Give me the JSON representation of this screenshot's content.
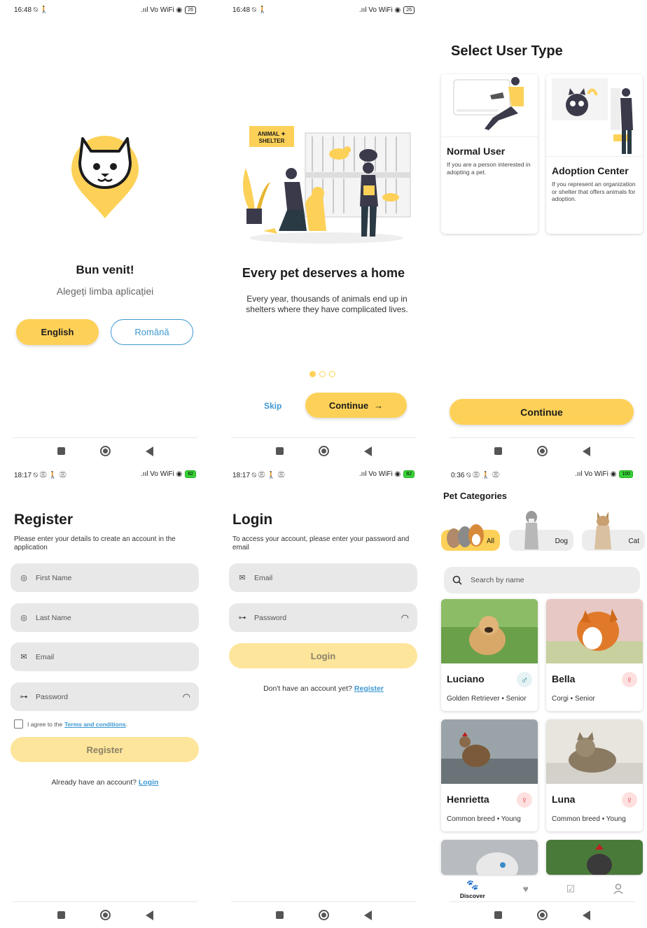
{
  "screen1": {
    "status": {
      "time": "16:48 ⍉ 🚶",
      "icons": ".ııl Vo WiFi ◉",
      "battery": "26"
    },
    "welcome": "Bun venit!",
    "subtitle": "Alegeți limba aplicației",
    "english": "English",
    "romana": "Română"
  },
  "screen2": {
    "status": {
      "time": "16:48 ⍉ 🚶",
      "icons": ".ııl Vo WiFi ◉",
      "battery": "26"
    },
    "sign": "ANIMAL SHELTER",
    "title": "Every pet deserves a home",
    "desc": "Every year, thousands of animals end up in shelters where they have complicated lives.",
    "skip": "Skip",
    "continue": "Continue",
    "arrow": "→"
  },
  "screen3": {
    "title": "Select User Type",
    "normal": {
      "name": "Normal User",
      "desc": "If you are a person interested in adopting a pet."
    },
    "center": {
      "name": "Adoption Center",
      "desc": "If you represent an organization or shelter that offers animals for adoption."
    },
    "continue": "Continue"
  },
  "screen4": {
    "status": {
      "time": "18:17 ⍉ ㊂ 🚶 ㊂",
      "icons": ".ııl Vo WiFi ◉",
      "battery": "82"
    },
    "title": "Register",
    "desc": "Please enter your details to create an account in the application",
    "first_name": "First Name",
    "last_name": "Last Name",
    "email": "Email",
    "password": "Password",
    "terms_prefix": "I agree to the",
    "terms_link": "Terms and conditions",
    "terms_suffix": ".",
    "register": "Register",
    "alt_text": "Already have an account?",
    "alt_link": "Login"
  },
  "screen5": {
    "status": {
      "time": "18:17 ⍉ ㊂ 🚶 ㊂",
      "icons": ".ııl Vo WiFi ◉",
      "battery": "82"
    },
    "title": "Login",
    "desc": "To access your account, please enter your password and email",
    "email": "Email",
    "password": "Password",
    "login": "Login",
    "alt_text": "Don't have an account yet?",
    "alt_link": "Register"
  },
  "screen6": {
    "status": {
      "time": "0:36 ⍉ ㊂ 🚶 ㊂",
      "icons": ".ııl Vo WiFi ◉",
      "battery": "100"
    },
    "title": "Pet Categories",
    "categories": [
      {
        "label": "All"
      },
      {
        "label": "Dog"
      },
      {
        "label": "Cat"
      }
    ],
    "search_placeholder": "Search by name",
    "pets": [
      {
        "name": "Luciano",
        "info": "Golden Retriever • Senior",
        "gender": "♂"
      },
      {
        "name": "Bella",
        "info": "Corgi • Senior",
        "gender": "♀"
      },
      {
        "name": "Henrietta",
        "info": "Common breed • Young",
        "gender": "♀"
      },
      {
        "name": "Luna",
        "info": "Common breed • Young",
        "gender": "♀"
      }
    ],
    "tabs": {
      "discover": "Discover"
    }
  },
  "colors": {
    "accent": "#fdd158",
    "link": "#3d98d1",
    "accent_light": "#fde59b"
  }
}
